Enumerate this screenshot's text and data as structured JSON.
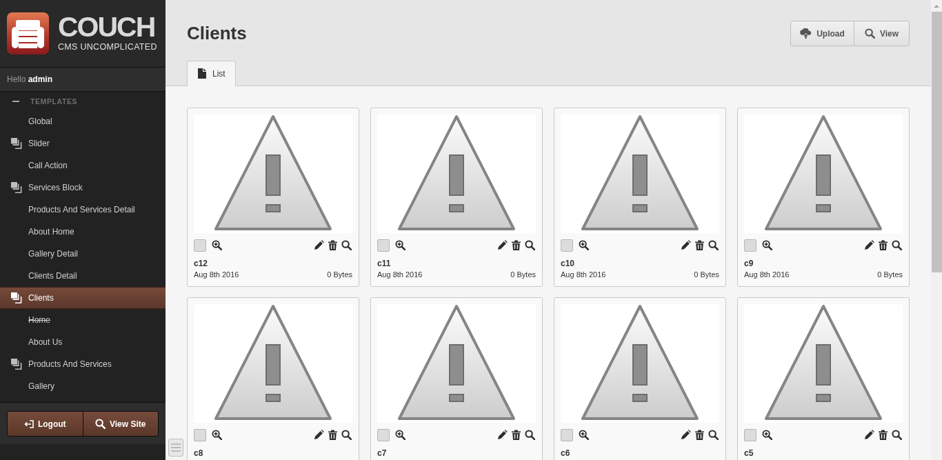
{
  "sidebar": {
    "logo": {
      "name": "COUCH",
      "tagline": "CMS UNCOMPLICATED"
    },
    "greeting": "Hello **admin**",
    "section": {
      "title": "TEMPLATES",
      "expanded": true
    },
    "items": [
      {
        "label": "Global",
        "kind": "single",
        "selected": false,
        "crossed_out": false
      },
      {
        "label": "Slider",
        "kind": "clonable",
        "selected": false,
        "crossed_out": false
      },
      {
        "label": "Call Action",
        "kind": "single",
        "selected": false,
        "crossed_out": false
      },
      {
        "label": "Services Block",
        "kind": "clonable",
        "selected": false,
        "crossed_out": false
      },
      {
        "label": "Products And Services Detail",
        "kind": "single",
        "selected": false,
        "crossed_out": false
      },
      {
        "label": "About Home",
        "kind": "single",
        "selected": false,
        "crossed_out": false
      },
      {
        "label": "Gallery Detail",
        "kind": "single",
        "selected": false,
        "crossed_out": false
      },
      {
        "label": "Clients Detail",
        "kind": "single",
        "selected": false,
        "crossed_out": false
      },
      {
        "label": "Clients",
        "kind": "clonable",
        "selected": true,
        "crossed_out": false
      },
      {
        "label": "Home",
        "kind": "single",
        "selected": false,
        "crossed_out": true
      },
      {
        "label": "About Us",
        "kind": "single",
        "selected": false,
        "crossed_out": false
      },
      {
        "label": "Products And Services",
        "kind": "clonable",
        "selected": false,
        "crossed_out": false
      },
      {
        "label": "Gallery",
        "kind": "single",
        "selected": false,
        "crossed_out": false
      }
    ],
    "buttons": [
      {
        "label": "Logout",
        "kind": "logout"
      },
      {
        "label": "View Site",
        "kind": "view"
      }
    ]
  },
  "header": {
    "title": "Clients",
    "buttons": [
      {
        "label": "Upload",
        "kind": "upload"
      },
      {
        "label": "View",
        "kind": "view"
      }
    ]
  },
  "tabs": [
    {
      "label": "List",
      "selected": true
    }
  ],
  "gallery": {
    "items": [
      {
        "name": "c12",
        "date": "Aug 8th 2016",
        "size": "0 Bytes",
        "checked": false
      },
      {
        "name": "c11",
        "date": "Aug 8th 2016",
        "size": "0 Bytes",
        "checked": false
      },
      {
        "name": "c10",
        "date": "Aug 8th 2016",
        "size": "0 Bytes",
        "checked": false
      },
      {
        "name": "c9",
        "date": "Aug 8th 2016",
        "size": "0 Bytes",
        "checked": false
      },
      {
        "name": "c8",
        "checked": false
      },
      {
        "name": "c7",
        "checked": false
      },
      {
        "name": "c6",
        "checked": false
      },
      {
        "name": "c5",
        "checked": false
      }
    ]
  }
}
